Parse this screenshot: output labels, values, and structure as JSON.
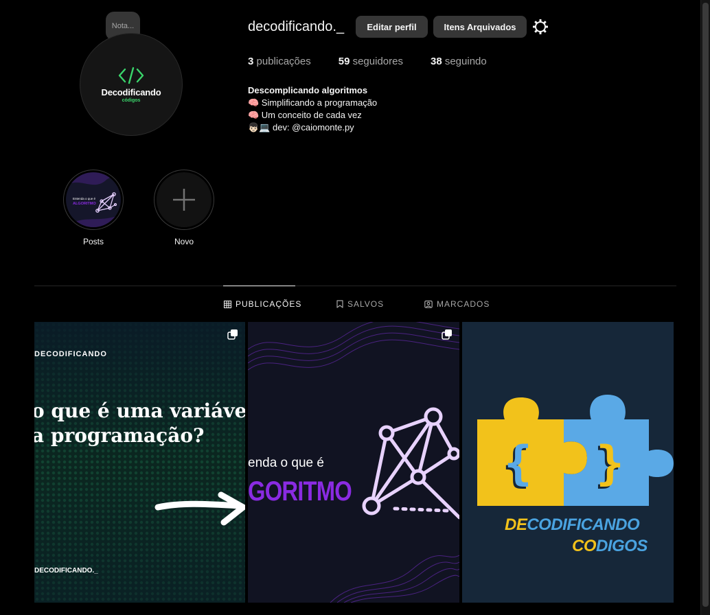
{
  "profile": {
    "note_label": "Nota...",
    "avatar_brand": "Decodificando",
    "avatar_brand_sub": "códigos",
    "username": "decodificando._",
    "edit_button": "Editar perfil",
    "archive_button": "Itens Arquivados",
    "stats": {
      "posts_count": "3",
      "posts_label": "publicações",
      "followers_count": "59",
      "followers_label": "seguidores",
      "following_count": "38",
      "following_label": "seguindo"
    },
    "bio": {
      "name": "Descomplicando algoritmos",
      "line1": "🧠 Simplificando a programação",
      "line2": "🧠 Um conceito de cada vez",
      "line3": "👦🏻💻 dev: @caiomonte.py"
    }
  },
  "highlights": [
    {
      "label": "Posts",
      "thumb_text_top": "Entenda o que é",
      "thumb_text_bottom": "ALGORITMO"
    },
    {
      "label": "Novo"
    }
  ],
  "tabs": [
    {
      "label": "PUBLICAÇÕES",
      "icon": "grid-icon",
      "active": true
    },
    {
      "label": "SALVOS",
      "icon": "bookmark-icon",
      "active": false
    },
    {
      "label": "MARCADOS",
      "icon": "tagged-icon",
      "active": false
    }
  ],
  "posts": [
    {
      "brand": "DECODIFICANDO",
      "title_line1": "o que é uma variável",
      "title_line2": "a programação?",
      "footer": "DECODIFICANDO._",
      "multi": true
    },
    {
      "line1": "enda o que é",
      "line2": "GORITMO",
      "multi": true
    },
    {
      "line1_accent": "DE",
      "line1_rest": "CODIFICANDO",
      "line2_accent": "CO",
      "line2_rest": "DIGOS",
      "multi": false
    }
  ],
  "colors": {
    "background": "#000000",
    "button_bg": "#363636",
    "muted_text": "#a8a8a8",
    "brand_green": "#3ad56b",
    "algoritmo_purple": "#8a2be2",
    "puzzle_yellow": "#f2c21b",
    "puzzle_blue": "#5aa9e6"
  }
}
